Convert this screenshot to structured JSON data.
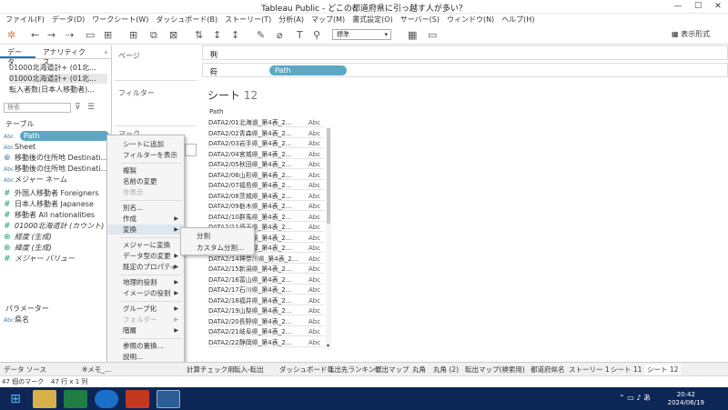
{
  "window": {
    "title": "Tableau Public - どこの都道府県に引っ越す人が多い？",
    "min": "—",
    "max": "☐",
    "close": "✕"
  },
  "menu": [
    "ファイル(F)",
    "データ(D)",
    "ワークシート(W)",
    "ダッシュボード(B)",
    "ストーリー(T)",
    "分析(A)",
    "マップ(M)",
    "書式設定(O)",
    "サーバー(S)",
    "ウィンドウ(N)",
    "ヘルプ(H)"
  ],
  "toolbar": {
    "format_value": "標準",
    "show_me": "表示形式"
  },
  "left_tabs": {
    "data": "データ",
    "analytics": "アナリティクス"
  },
  "sources": [
    "01000北海道計+ (01北...",
    "01000北海道計+ (01北...",
    "転入者数(日本人移動者)..."
  ],
  "search_placeholder": "検索",
  "tables_label": "テーブル",
  "fields": [
    {
      "type": "Abc",
      "name": "Path"
    },
    {
      "type": "Abc",
      "name": "Sheet"
    },
    {
      "type": "⊕",
      "name": "移動後の住所地 Destinati..."
    },
    {
      "type": "Abc",
      "name": "移動後の住所地 Destinati..."
    },
    {
      "type": "Abc",
      "name": "メジャー ネーム"
    },
    {
      "type": "#",
      "name": "外国人移動者 Foreigners"
    },
    {
      "type": "#",
      "name": "日本人移動者 Japanese"
    },
    {
      "type": "#",
      "name": "移動者 All nationalities"
    },
    {
      "type": "#",
      "name": "01000北海道計 (カウント)"
    },
    {
      "type": "⊕",
      "name": "経度 (生成)"
    },
    {
      "type": "⊕",
      "name": "緯度 (生成)"
    },
    {
      "type": "#",
      "name": "メジャー バリュー"
    }
  ],
  "params_label": "パラメーター",
  "params": [
    {
      "type": "Abc",
      "name": "県名"
    }
  ],
  "pages_label": "ページ",
  "filters_label": "フィルター",
  "marks_label": "マーク",
  "columns_label": "列",
  "rows_label": "行",
  "row_pill": "Path",
  "sheet": {
    "name": "シート",
    "num": "12",
    "col_header": "Path",
    "abc": "Abc",
    "rows": [
      "DATA2/01北海道_第4表_2...",
      "DATA2/02青森県_第4表_2...",
      "DATA2/03岩手県_第4表_2...",
      "DATA2/04宮城県_第4表_2...",
      "DATA2/05秋田県_第4表_2...",
      "DATA2/06山形県_第4表_2...",
      "DATA2/07福島県_第4表_2...",
      "DATA2/08茨城県_第4表_2...",
      "DATA2/09栃木県_第4表_2...",
      "DATA2/10群馬県_第4表_2...",
      "DATA2/11埼玉県_第4表_2...",
      "DATA2/12千葉県_第4表_2...",
      "DATA2/13東京都_第4表_2...",
      "DATA2/14神奈川県_第4表_2...",
      "DATA2/15新潟県_第4表_2...",
      "DATA2/16富山県_第4表_2...",
      "DATA2/17石川県_第4表_2...",
      "DATA2/18福井県_第4表_2...",
      "DATA2/19山梨県_第4表_2...",
      "DATA2/20長野県_第4表_2...",
      "DATA2/21岐阜県_第4表_2...",
      "DATA2/22静岡県_第4表_2..."
    ]
  },
  "context_menu": [
    {
      "label": "シートに追加",
      "sep_before": false
    },
    {
      "label": "フィルターを表示"
    },
    {
      "label": "複製",
      "sep_before": true
    },
    {
      "label": "名前の変更"
    },
    {
      "label": "非表示",
      "disabled": true
    },
    {
      "label": "別名...",
      "sep_before": true
    },
    {
      "label": "作成",
      "sub": true
    },
    {
      "label": "変換",
      "sub": true,
      "selected": true
    },
    {
      "label": "メジャーに変換",
      "sep_before": true
    },
    {
      "label": "データ型の変更",
      "sub": true
    },
    {
      "label": "既定のプロパティ",
      "sub": true
    },
    {
      "label": "地理的役割",
      "sub": true,
      "sep_before": true
    },
    {
      "label": "イメージの役割",
      "sub": true
    },
    {
      "label": "グループ化",
      "sub": true,
      "sep_before": true
    },
    {
      "label": "フォルダー",
      "sub": true,
      "disabled": true
    },
    {
      "label": "階層",
      "sub": true
    },
    {
      "label": "参照の置換...",
      "sep_before": true
    },
    {
      "label": "説明..."
    }
  ],
  "submenu": [
    "分割",
    "カスタム分割..."
  ],
  "sheet_tabs": [
    "データ ソース",
    "※メモ_...",
    "計算チェック用",
    "転入-転出",
    "ダッシュボード 1",
    "転出先ランキング",
    "転出マップ",
    "丸角",
    "丸角 (2)",
    "転出マップ(検索用)",
    "都道府県名",
    "ストーリー 1",
    "シート 11",
    "シート 12"
  ],
  "status": {
    "marks": "47 個のマーク",
    "dims": "47 行 x 1 列"
  },
  "clock": {
    "time": "20:42",
    "date": "2024/06/19"
  },
  "colors": {
    "pill": "#5ea8c4",
    "taskbar": "#0c2656",
    "accent": "#1f77b4"
  }
}
